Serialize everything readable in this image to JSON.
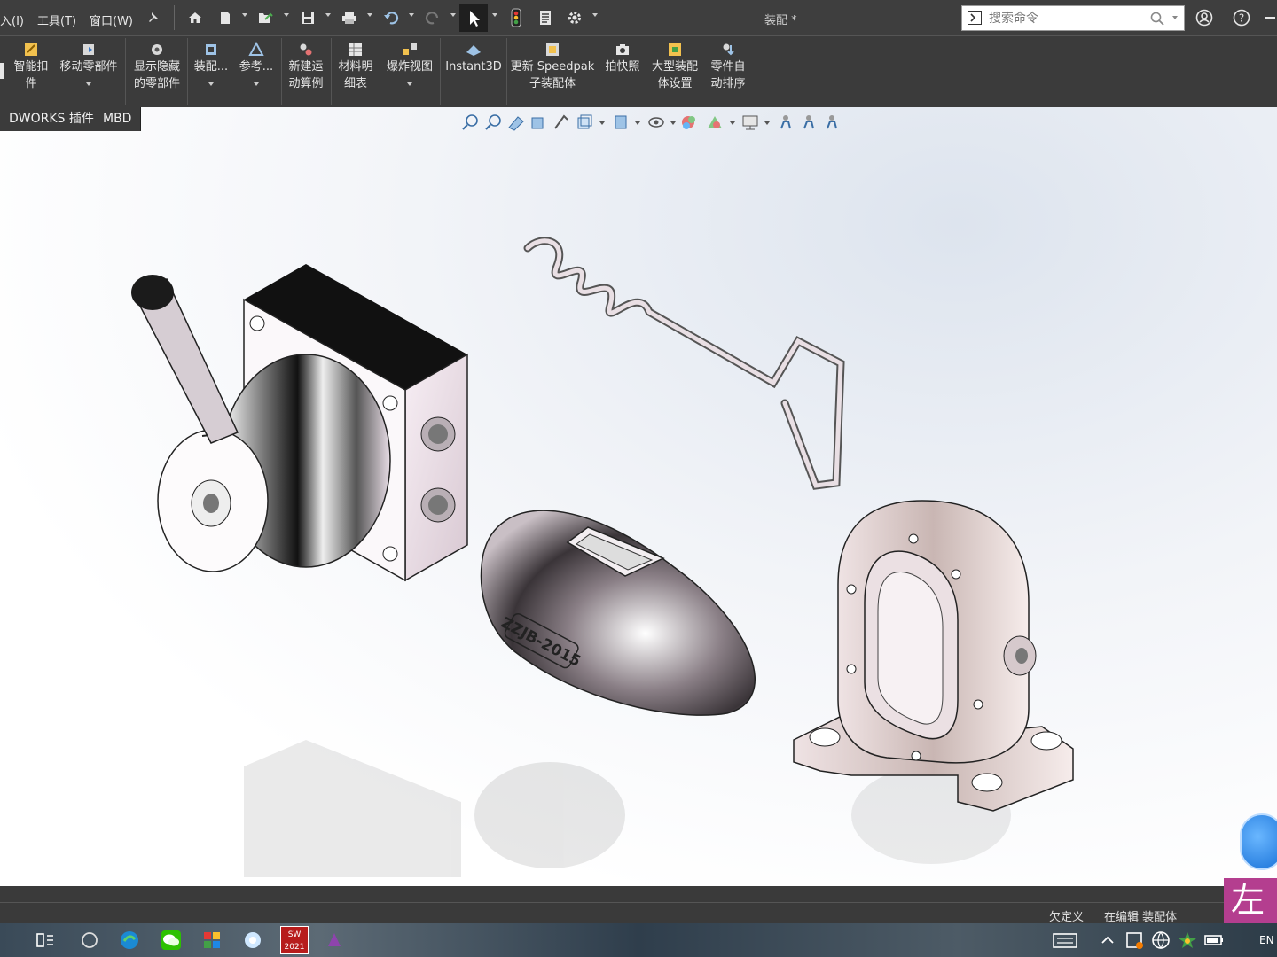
{
  "menu": {
    "items": [
      "入(I)",
      "工具(T)",
      "窗口(W)"
    ]
  },
  "title": "装配 *",
  "search": {
    "placeholder": "搜索命令"
  },
  "commands": [
    {
      "label": "智能扣\n件"
    },
    {
      "label": "移动零部件"
    },
    {
      "label": "显示隐藏\n的零部件"
    },
    {
      "label": "装配..."
    },
    {
      "label": "参考..."
    },
    {
      "label": "新建运\n动算例"
    },
    {
      "label": "材料明\n细表"
    },
    {
      "label": "爆炸视图"
    },
    {
      "label": "Instant3D"
    },
    {
      "label": "更新 Speedpak\n子装配体"
    },
    {
      "label": "拍快照"
    },
    {
      "label": "大型装配\n体设置"
    },
    {
      "label": "零件自\n动排序"
    }
  ],
  "tabs": [
    {
      "label": "DWORKS 插件"
    },
    {
      "label": "MBD"
    }
  ],
  "parts": {
    "cover_engraving": "ZZJB-2015"
  },
  "status": {
    "state": "欠定义",
    "mode": "在编辑 装配体"
  },
  "overlay_badge": "左",
  "taskbar": {
    "app_badge": "SW 2021",
    "lang": "EN"
  },
  "colors": {
    "toolbar_bg": "#3b3b3b",
    "titlebar_bg": "#3e3e3e",
    "accent_select": "#1f1f1f",
    "overlay_badge": "#b43e8f"
  }
}
